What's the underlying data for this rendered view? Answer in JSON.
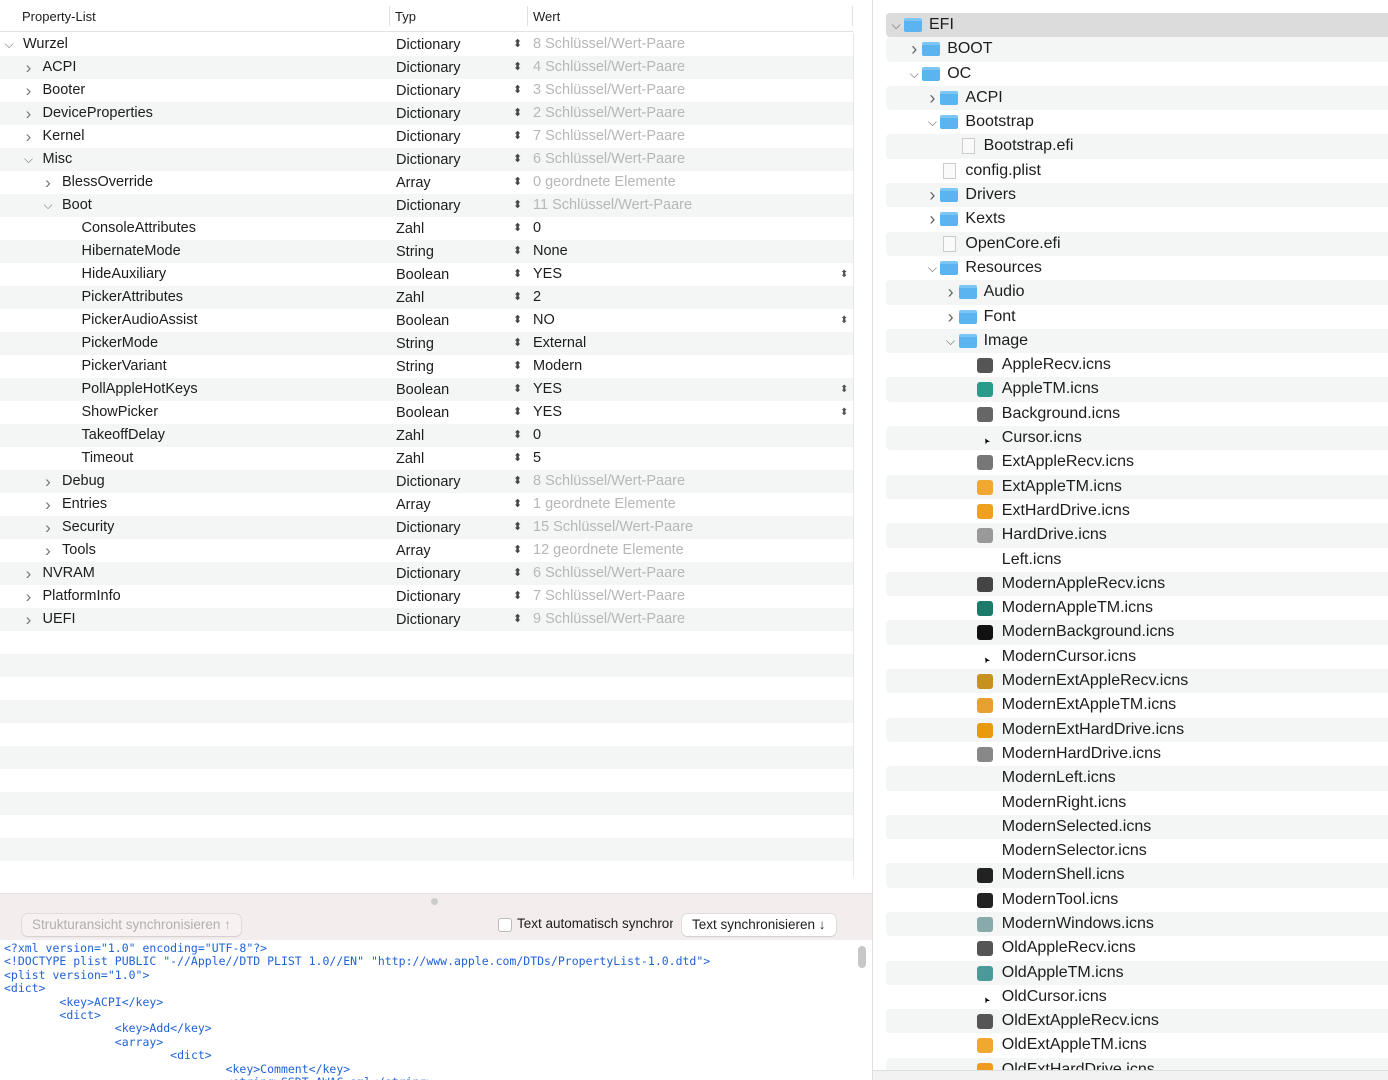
{
  "plist": {
    "headers": {
      "key": "Property-List",
      "type": "Typ",
      "value": "Wert"
    },
    "rows": [
      {
        "key": "Wurzel",
        "level": 0,
        "exp": "open",
        "type": "Dictionary",
        "value": "8 Schlüssel/Wert-Paare",
        "dim": true
      },
      {
        "key": "ACPI",
        "level": 1,
        "exp": "closed",
        "type": "Dictionary",
        "value": "4 Schlüssel/Wert-Paare",
        "dim": true
      },
      {
        "key": "Booter",
        "level": 1,
        "exp": "closed",
        "type": "Dictionary",
        "value": "3 Schlüssel/Wert-Paare",
        "dim": true
      },
      {
        "key": "DeviceProperties",
        "level": 1,
        "exp": "closed",
        "type": "Dictionary",
        "value": "2 Schlüssel/Wert-Paare",
        "dim": true
      },
      {
        "key": "Kernel",
        "level": 1,
        "exp": "closed",
        "type": "Dictionary",
        "value": "7 Schlüssel/Wert-Paare",
        "dim": true
      },
      {
        "key": "Misc",
        "level": 1,
        "exp": "open",
        "type": "Dictionary",
        "value": "6 Schlüssel/Wert-Paare",
        "dim": true
      },
      {
        "key": "BlessOverride",
        "level": 2,
        "exp": "closed",
        "type": "Array",
        "value": "0 geordnete Elemente",
        "dim": true
      },
      {
        "key": "Boot",
        "level": 2,
        "exp": "open",
        "type": "Dictionary",
        "value": "11 Schlüssel/Wert-Paare",
        "dim": true
      },
      {
        "key": "ConsoleAttributes",
        "level": 3,
        "type": "Zahl",
        "value": "0"
      },
      {
        "key": "HibernateMode",
        "level": 3,
        "type": "String",
        "value": "None"
      },
      {
        "key": "HideAuxiliary",
        "level": 3,
        "type": "Boolean",
        "value": "YES",
        "bool": true
      },
      {
        "key": "PickerAttributes",
        "level": 3,
        "type": "Zahl",
        "value": "2"
      },
      {
        "key": "PickerAudioAssist",
        "level": 3,
        "type": "Boolean",
        "value": "NO",
        "bool": true
      },
      {
        "key": "PickerMode",
        "level": 3,
        "type": "String",
        "value": "External"
      },
      {
        "key": "PickerVariant",
        "level": 3,
        "type": "String",
        "value": "Modern"
      },
      {
        "key": "PollAppleHotKeys",
        "level": 3,
        "type": "Boolean",
        "value": "YES",
        "bool": true
      },
      {
        "key": "ShowPicker",
        "level": 3,
        "type": "Boolean",
        "value": "YES",
        "bool": true
      },
      {
        "key": "TakeoffDelay",
        "level": 3,
        "type": "Zahl",
        "value": "0"
      },
      {
        "key": "Timeout",
        "level": 3,
        "type": "Zahl",
        "value": "5"
      },
      {
        "key": "Debug",
        "level": 2,
        "exp": "closed",
        "type": "Dictionary",
        "value": "8 Schlüssel/Wert-Paare",
        "dim": true
      },
      {
        "key": "Entries",
        "level": 2,
        "exp": "closed",
        "type": "Array",
        "value": "1 geordnete Elemente",
        "dim": true
      },
      {
        "key": "Security",
        "level": 2,
        "exp": "closed",
        "type": "Dictionary",
        "value": "15 Schlüssel/Wert-Paare",
        "dim": true
      },
      {
        "key": "Tools",
        "level": 2,
        "exp": "closed",
        "type": "Array",
        "value": "12 geordnete Elemente",
        "dim": true
      },
      {
        "key": "NVRAM",
        "level": 1,
        "exp": "closed",
        "type": "Dictionary",
        "value": "6 Schlüssel/Wert-Paare",
        "dim": true
      },
      {
        "key": "PlatformInfo",
        "level": 1,
        "exp": "closed",
        "type": "Dictionary",
        "value": "7 Schlüssel/Wert-Paare",
        "dim": true
      },
      {
        "key": "UEFI",
        "level": 1,
        "exp": "closed",
        "type": "Dictionary",
        "value": "9 Schlüssel/Wert-Paare",
        "dim": true
      }
    ]
  },
  "sync": {
    "struct_button": "Strukturansicht synchronisieren ↑",
    "auto_label": "Text automatisch synchronisieren",
    "text_button": "Text synchronisieren ↓"
  },
  "code_lines": [
    "<?xml version=\"1.0\" encoding=\"UTF-8\"?>",
    "<!DOCTYPE plist PUBLIC \"-//Apple//DTD PLIST 1.0//EN\" \"http://www.apple.com/DTDs/PropertyList-1.0.dtd\">",
    "<plist version=\"1.0\">",
    "<dict>",
    "\t<key>ACPI</key>",
    "\t<dict>",
    "\t\t<key>Add</key>",
    "\t\t<array>",
    "\t\t\t<dict>",
    "\t\t\t\t<key>Comment</key>",
    "\t\t\t\t<string>SSDT-AWAC.aml</string>"
  ],
  "files": [
    {
      "name": "EFI",
      "level": 0,
      "exp": "open",
      "kind": "folder",
      "selected": true
    },
    {
      "name": "BOOT",
      "level": 1,
      "exp": "closed",
      "kind": "folder"
    },
    {
      "name": "OC",
      "level": 1,
      "exp": "open",
      "kind": "folder"
    },
    {
      "name": "ACPI",
      "level": 2,
      "exp": "closed",
      "kind": "folder"
    },
    {
      "name": "Bootstrap",
      "level": 2,
      "exp": "open",
      "kind": "folder"
    },
    {
      "name": "Bootstrap.efi",
      "level": 3,
      "kind": "doc"
    },
    {
      "name": "config.plist",
      "level": 2,
      "kind": "doc"
    },
    {
      "name": "Drivers",
      "level": 2,
      "exp": "closed",
      "kind": "folder"
    },
    {
      "name": "Kexts",
      "level": 2,
      "exp": "closed",
      "kind": "folder"
    },
    {
      "name": "OpenCore.efi",
      "level": 2,
      "kind": "doc"
    },
    {
      "name": "Resources",
      "level": 2,
      "exp": "open",
      "kind": "folder"
    },
    {
      "name": "Audio",
      "level": 3,
      "exp": "closed",
      "kind": "folder"
    },
    {
      "name": "Font",
      "level": 3,
      "exp": "closed",
      "kind": "folder"
    },
    {
      "name": "Image",
      "level": 3,
      "exp": "open",
      "kind": "folder"
    },
    {
      "name": "AppleRecv.icns",
      "level": 4,
      "kind": "icns",
      "color": "#555"
    },
    {
      "name": "AppleTM.icns",
      "level": 4,
      "kind": "icns",
      "color": "#2a9a8a"
    },
    {
      "name": "Background.icns",
      "level": 4,
      "kind": "icns",
      "color": "#666"
    },
    {
      "name": "Cursor.icns",
      "level": 4,
      "kind": "cursor"
    },
    {
      "name": "ExtAppleRecv.icns",
      "level": 4,
      "kind": "icns",
      "color": "#777"
    },
    {
      "name": "ExtAppleTM.icns",
      "level": 4,
      "kind": "icns",
      "color": "#f0a830"
    },
    {
      "name": "ExtHardDrive.icns",
      "level": 4,
      "kind": "icns",
      "color": "#f0a020"
    },
    {
      "name": "HardDrive.icns",
      "level": 4,
      "kind": "icns",
      "color": "#999"
    },
    {
      "name": "Left.icns",
      "level": 4,
      "kind": "none"
    },
    {
      "name": "ModernAppleRecv.icns",
      "level": 4,
      "kind": "icns",
      "color": "#444"
    },
    {
      "name": "ModernAppleTM.icns",
      "level": 4,
      "kind": "icns",
      "color": "#1e7a6a"
    },
    {
      "name": "ModernBackground.icns",
      "level": 4,
      "kind": "icns",
      "color": "#111"
    },
    {
      "name": "ModernCursor.icns",
      "level": 4,
      "kind": "cursor"
    },
    {
      "name": "ModernExtAppleRecv.icns",
      "level": 4,
      "kind": "icns",
      "color": "#c89020"
    },
    {
      "name": "ModernExtAppleTM.icns",
      "level": 4,
      "kind": "icns",
      "color": "#e8a030"
    },
    {
      "name": "ModernExtHardDrive.icns",
      "level": 4,
      "kind": "icns",
      "color": "#e89a10"
    },
    {
      "name": "ModernHardDrive.icns",
      "level": 4,
      "kind": "icns",
      "color": "#888"
    },
    {
      "name": "ModernLeft.icns",
      "level": 4,
      "kind": "none"
    },
    {
      "name": "ModernRight.icns",
      "level": 4,
      "kind": "none"
    },
    {
      "name": "ModernSelected.icns",
      "level": 4,
      "kind": "none"
    },
    {
      "name": "ModernSelector.icns",
      "level": 4,
      "kind": "none"
    },
    {
      "name": "ModernShell.icns",
      "level": 4,
      "kind": "icns",
      "color": "#222"
    },
    {
      "name": "ModernTool.icns",
      "level": 4,
      "kind": "icns",
      "color": "#222"
    },
    {
      "name": "ModernWindows.icns",
      "level": 4,
      "kind": "icns",
      "color": "#8aa"
    },
    {
      "name": "OldAppleRecv.icns",
      "level": 4,
      "kind": "icns",
      "color": "#555"
    },
    {
      "name": "OldAppleTM.icns",
      "level": 4,
      "kind": "icns",
      "color": "#4a9a9a"
    },
    {
      "name": "OldCursor.icns",
      "level": 4,
      "kind": "cursor"
    },
    {
      "name": "OldExtAppleRecv.icns",
      "level": 4,
      "kind": "icns",
      "color": "#555"
    },
    {
      "name": "OldExtAppleTM.icns",
      "level": 4,
      "kind": "icns",
      "color": "#f0a830"
    },
    {
      "name": "OldExtHardDrive.icns",
      "level": 4,
      "kind": "icns",
      "color": "#f09a20"
    }
  ]
}
